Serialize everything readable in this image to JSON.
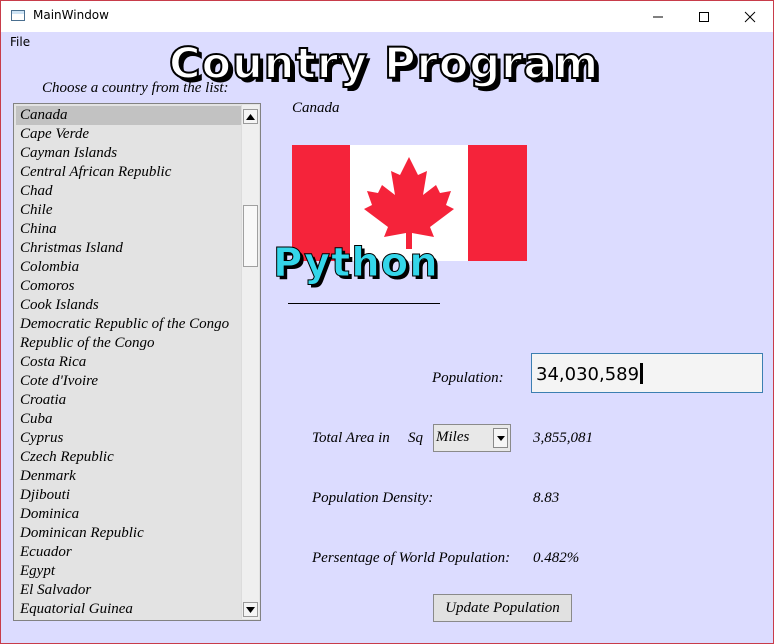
{
  "window": {
    "title": "MainWindow"
  },
  "menu": {
    "file": "File"
  },
  "banner": "Country Program",
  "prompt": "Choose a country from the list:",
  "countries": [
    "Canada",
    "Cape Verde",
    "Cayman Islands",
    "Central African Republic",
    "Chad",
    "Chile",
    "China",
    "Christmas Island",
    "Colombia",
    "Comoros",
    "Cook Islands",
    "Democratic Republic of the Congo",
    "Republic of the Congo",
    "Costa Rica",
    "Cote d'Ivoire",
    "Croatia",
    "Cuba",
    "Cyprus",
    "Czech Republic",
    "Denmark",
    "Djibouti",
    "Dominica",
    "Dominican Republic",
    "Ecuador",
    "Egypt",
    "El Salvador",
    "Equatorial Guinea"
  ],
  "selected_country": "Canada",
  "flag": {
    "icon": "canada-flag",
    "red": "#f5233a",
    "white": "#ffffff"
  },
  "python_logo": "Python",
  "population": {
    "label": "Population:",
    "value": "34,030,589"
  },
  "area": {
    "label": "Total Area in",
    "sq": "Sq",
    "unit": "Miles",
    "value": "3,855,081"
  },
  "density": {
    "label": "Population Density:",
    "value": "8.83"
  },
  "world_pct": {
    "label": "Persentage of World Population:",
    "value": "0.482%"
  },
  "buttons": {
    "update": "Update Population"
  },
  "colors": {
    "background": "#dcdcff",
    "accent": "#34d6ea"
  }
}
